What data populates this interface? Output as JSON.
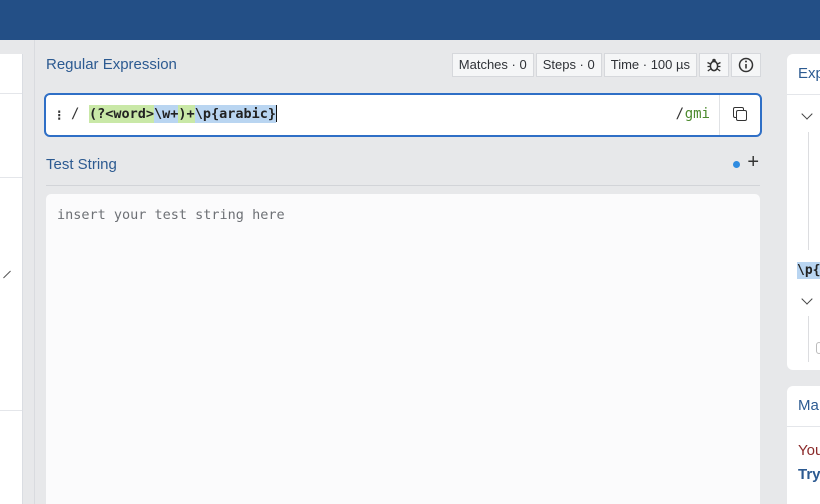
{
  "regex_panel": {
    "title": "Regular Expression",
    "stats": {
      "matches": "Matches · 0",
      "steps": "Steps · 0",
      "time": "Time · 100 µs"
    },
    "icons": {
      "debugger": "bug-icon",
      "info": "info-icon"
    },
    "delimiter_open": "/",
    "delimiter_close": "/",
    "pattern_segments": [
      {
        "text": "(?<word>",
        "group": 1
      },
      {
        "text": "\\w+",
        "group": 2
      },
      {
        "text": ")+",
        "group": 1
      },
      {
        "text": "\\p{arabic}",
        "group": 2
      }
    ],
    "flags": "gmi"
  },
  "test_string": {
    "title": "Test String",
    "placeholder": "insert your test string here"
  },
  "explanation_panel": {
    "title": "Exp",
    "token": "\\p{"
  },
  "match_panel": {
    "title": "Ma",
    "line1": "You",
    "line2": "Try"
  },
  "colors": {
    "topbar": "#234f86",
    "accent_blue": "#2f6fc6",
    "group1_highlight": "#c9e8a7",
    "group2_highlight": "#b9d5f1",
    "flags_green": "#4c8a2e"
  }
}
